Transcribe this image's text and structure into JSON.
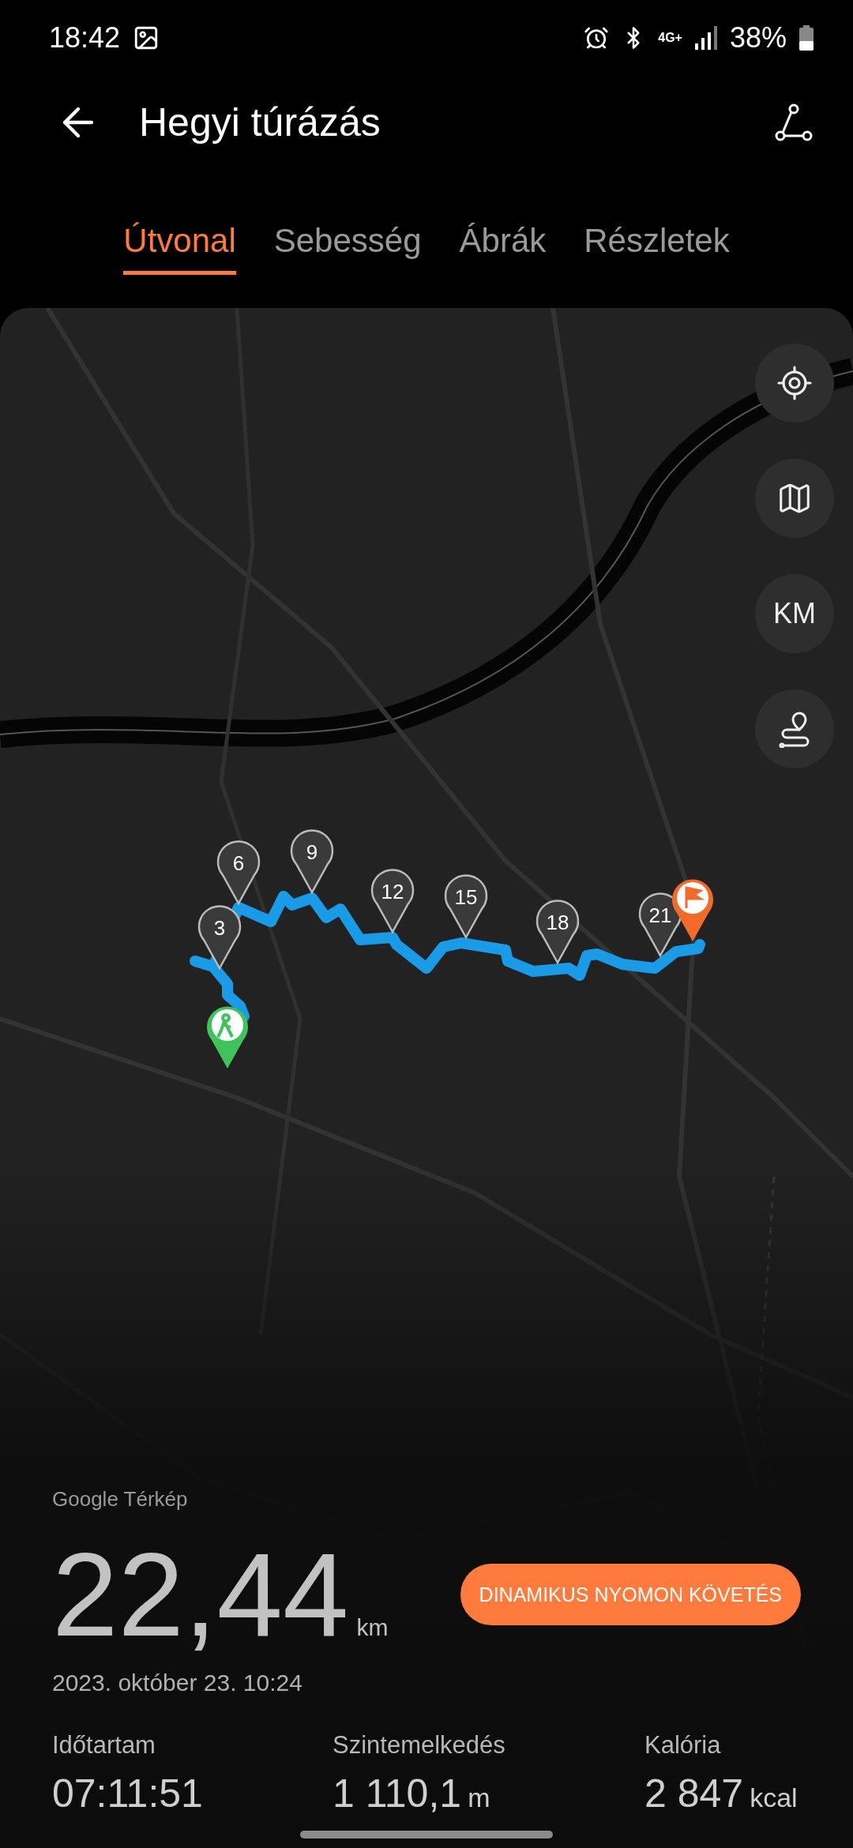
{
  "status_bar": {
    "time": "18:42",
    "network": "4G+",
    "battery": "38%"
  },
  "header": {
    "title": "Hegyi túrázás"
  },
  "tabs": [
    {
      "label": "Útvonal",
      "selected": true
    },
    {
      "label": "Sebesség",
      "selected": false
    },
    {
      "label": "Ábrák",
      "selected": false
    },
    {
      "label": "Részletek",
      "selected": false
    }
  ],
  "map": {
    "controls": [
      {
        "kind": "locate"
      },
      {
        "kind": "layers"
      },
      {
        "kind": "units",
        "label": "KM"
      },
      {
        "kind": "route"
      }
    ],
    "markers": [
      {
        "kind": "start"
      },
      {
        "kind": "km",
        "label": "3"
      },
      {
        "kind": "km",
        "label": "6"
      },
      {
        "kind": "km",
        "label": "9"
      },
      {
        "kind": "km",
        "label": "12"
      },
      {
        "kind": "km",
        "label": "15"
      },
      {
        "kind": "km",
        "label": "18"
      },
      {
        "kind": "km",
        "label": "21"
      },
      {
        "kind": "finish"
      }
    ],
    "attribution": "Google Térkép"
  },
  "summary": {
    "distance": "22,44",
    "unit": "km",
    "date": "2023. október 23. 10:24",
    "button": "DINAMIKUS NYOMON KÖVETÉS"
  },
  "stats": [
    {
      "label": "Időtartam",
      "value": "07:11:51"
    },
    {
      "label": "Szintemelkedés",
      "value": "1 110,1",
      "unit": "m"
    },
    {
      "label": "Kalória",
      "value": "2 847",
      "unit": "kcal"
    }
  ]
}
